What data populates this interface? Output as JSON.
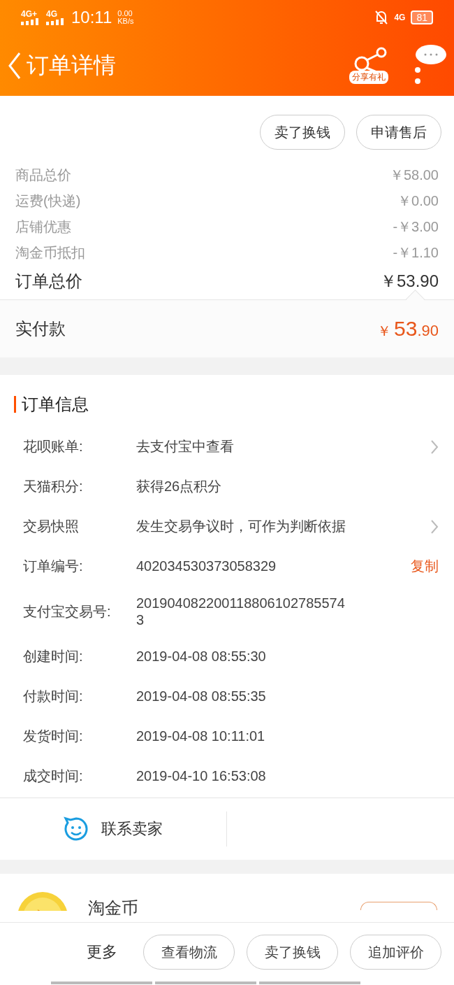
{
  "status_bar": {
    "signal_1": "4G+",
    "signal_2": "4G",
    "time": "10:11",
    "speed": "0.00",
    "speed_unit": "KB/s",
    "network": "4G",
    "battery": "81"
  },
  "header": {
    "title": "订单详情",
    "share_label": "分享有礼"
  },
  "top_buttons": [
    "卖了换钱",
    "申请售后"
  ],
  "price_rows": [
    {
      "label": "商品总价",
      "value": "￥58.00"
    },
    {
      "label": "运费(快递)",
      "value": "￥0.00"
    },
    {
      "label": "店铺优惠",
      "value": "-￥3.00"
    },
    {
      "label": "淘金币抵扣",
      "value": "-￥1.10"
    }
  ],
  "order_total": {
    "label": "订单总价",
    "value": "￥53.90"
  },
  "paid": {
    "label": "实付款",
    "currency": "￥",
    "integer": "53",
    "decimal": ".90"
  },
  "order_info": {
    "title": "订单信息",
    "rows": [
      {
        "label": "花呗账单:",
        "value": "去支付宝中查看",
        "kind": "link"
      },
      {
        "label": "天猫积分:",
        "value": "获得26点积分",
        "kind": "plain"
      },
      {
        "label": "交易快照",
        "value": "发生交易争议时，可作为判断依据",
        "kind": "link"
      },
      {
        "label": "订单编号:",
        "value": "402034530373058329",
        "kind": "copy",
        "action": "复制"
      },
      {
        "label": "支付宝交易号:",
        "value": "2019040822001188061027855743",
        "kind": "wrap"
      },
      {
        "label": "创建时间:",
        "value": "2019-04-08 08:55:30",
        "kind": "plain"
      },
      {
        "label": "付款时间:",
        "value": "2019-04-08 08:55:35",
        "kind": "plain"
      },
      {
        "label": "发货时间:",
        "value": "2019-04-08 10:11:01",
        "kind": "plain"
      },
      {
        "label": "成交时间:",
        "value": "2019-04-10 16:53:08",
        "kind": "plain"
      }
    ]
  },
  "contact": {
    "label": "联系卖家"
  },
  "coin": {
    "title": "淘金币"
  },
  "bottom_bar": {
    "more": "更多",
    "buttons": [
      "查看物流",
      "卖了换钱",
      "追加评价"
    ]
  }
}
